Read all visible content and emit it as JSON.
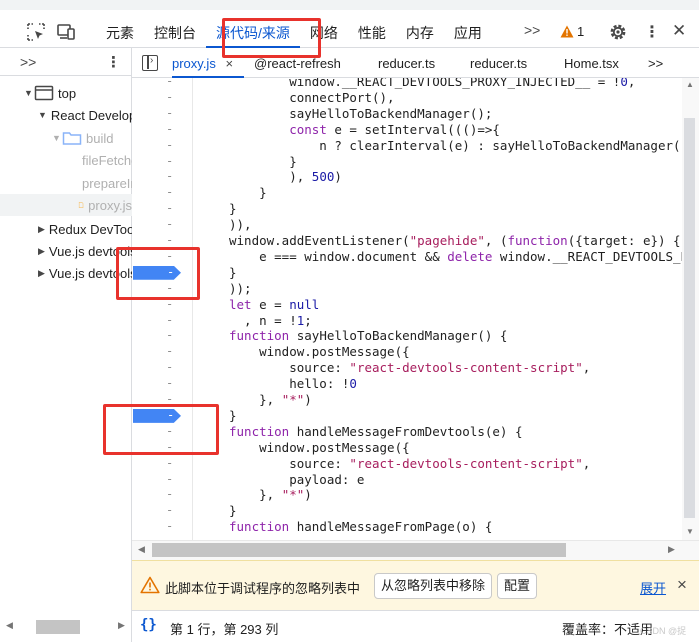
{
  "toolbar": {
    "tabs": [
      "元素",
      "控制台",
      "源代码/来源",
      "网络",
      "性能",
      "内存",
      "应用"
    ],
    "more": ">>",
    "warning_count": "1"
  },
  "sidebar": {
    "chevron": ">>",
    "items": [
      {
        "label": "top"
      },
      {
        "label": "React Developer Tools"
      },
      {
        "label": "build"
      },
      {
        "label": "fileFetcher.js"
      },
      {
        "label": "prepareInjection.js"
      },
      {
        "label": "proxy.js"
      },
      {
        "label": "Redux DevTools"
      },
      {
        "label": "Vue.js devtools"
      },
      {
        "label": "Vue.js devtools"
      }
    ]
  },
  "editor": {
    "tabs": [
      {
        "label": "proxy.js",
        "close": "×"
      },
      {
        "label": "@react-refresh"
      },
      {
        "label": "reducer.ts"
      },
      {
        "label": "reducer.ts"
      },
      {
        "label": "Home.tsx"
      }
    ],
    "more": ">>",
    "gutter_mark": "-",
    "breakpoint_lines": [
      12,
      21
    ],
    "code_lines": [
      "        window.__REACT_DEVTOOLS_PROXY_INJECTED__ = !0,",
      "        connectPort(),",
      "        sayHelloToBackendManager();",
      "        const e = setInterval((()=>{",
      "            n ? clearInterval(e) : sayHelloToBackendManager()",
      "        }",
      "        ), 500)",
      "    }",
      "}",
      ")),",
      "window.addEventListener(\"pagehide\", (function({target: e}) {",
      "    e === window.document && delete window.__REACT_DEVTOOLS_P",
      "}",
      "));",
      "let e = null",
      "  , n = !1;",
      "function sayHelloToBackendManager() {",
      "    window.postMessage({",
      "        source: \"react-devtools-content-script\",",
      "        hello: !0",
      "    }, \"*\")",
      "}",
      "function handleMessageFromDevtools(e) {",
      "    window.postMessage({",
      "        source: \"react-devtools-content-script\",",
      "        payload: e",
      "    }, \"*\")",
      "}",
      "function handleMessageFromPage(o) {"
    ]
  },
  "notice": {
    "text": "此脚本位于调试程序的忽略列表中",
    "remove_button": "从忽略列表中移除",
    "config_button": "配置",
    "expand_link": "展开",
    "close": "×"
  },
  "status": {
    "braces": "{}",
    "position": "第 1 行，第 293 列",
    "coverage": "覆盖率：不适用",
    "watermark": "CSDN @捉"
  },
  "colors": {
    "accent": "#0b57d0",
    "breakpoint": "#4285f4",
    "annotation": "#e8322c",
    "notice_bg": "#fef7e0"
  }
}
